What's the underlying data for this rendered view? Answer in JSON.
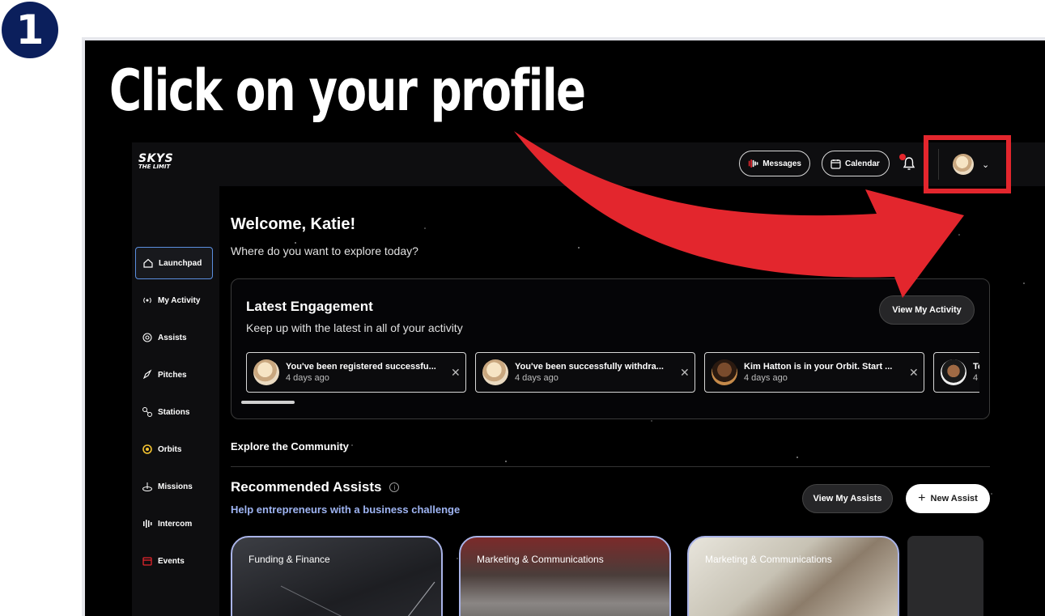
{
  "step": {
    "number": "1"
  },
  "instruction": {
    "text": "Click on your profile"
  },
  "colors": {
    "accent_red": "#e3262d",
    "step_blue": "#0b1f5c",
    "link_blue": "#9eb4f2",
    "active_border": "#5b8fe0"
  },
  "app": {
    "logo_line1": "SKYS",
    "logo_line2": "THE LIMIT"
  },
  "topbar": {
    "messages_label": "Messages",
    "calendar_label": "Calendar",
    "bell_icon": "bell-icon",
    "profile_chevron": "⌄"
  },
  "sidebar": {
    "items": [
      {
        "label": "Launchpad",
        "icon": "home-icon"
      },
      {
        "label": "My Activity",
        "icon": "broadcast-icon"
      },
      {
        "label": "Assists",
        "icon": "assist-icon"
      },
      {
        "label": "Pitches",
        "icon": "rocket-icon"
      },
      {
        "label": "Stations",
        "icon": "stations-icon"
      },
      {
        "label": "Orbits",
        "icon": "orbit-icon"
      },
      {
        "label": "Missions",
        "icon": "mission-icon"
      },
      {
        "label": "Intercom",
        "icon": "intercom-icon"
      },
      {
        "label": "Events",
        "icon": "calendar-event-icon"
      }
    ]
  },
  "main": {
    "welcome": "Welcome, Katie!",
    "subtitle": "Where do you want to explore today?",
    "engagement": {
      "title": "Latest Engagement",
      "subtitle": "Keep up with the latest in all of your activity",
      "button": "View My Activity",
      "notifications": [
        {
          "title": "You've been registered successfu...",
          "time": "4 days ago"
        },
        {
          "title": "You've been successfully withdra...",
          "time": "4 days ago"
        },
        {
          "title": "Kim Hatton is in your Orbit. Start ...",
          "time": "4 days ago"
        },
        {
          "title": "Te",
          "time": "4"
        }
      ]
    },
    "explore_title": "Explore the Community",
    "recommended": {
      "title": "Recommended Assists",
      "subtitle": "Help entrepreneurs with a business challenge",
      "view_button": "View My Assists",
      "new_button": "New Assist",
      "cards": [
        {
          "label": "Funding & Finance"
        },
        {
          "label": "Marketing & Communications"
        },
        {
          "label": "Marketing & Communications"
        }
      ]
    }
  }
}
